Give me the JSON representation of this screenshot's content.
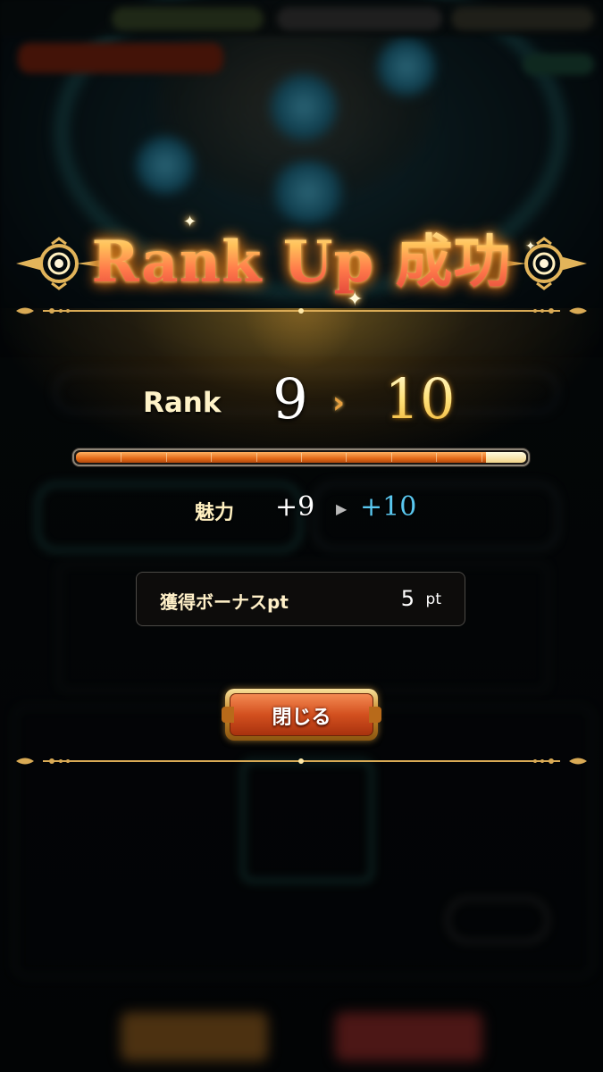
{
  "dialog": {
    "title": "Rank Up 成功",
    "rank": {
      "label": "Rank",
      "old_value": "9",
      "new_value": "10"
    },
    "progress": {
      "fraction": 0.91,
      "segments": 10
    },
    "stat": {
      "label": "魅力",
      "old_value": "+9",
      "new_value": "+10"
    },
    "bonus": {
      "label": "獲得ボーナスpt",
      "value": "5",
      "unit": "pt"
    },
    "close_button": "閉じる"
  },
  "colors": {
    "title_gradient_top": "#fff2b8",
    "title_gradient_bottom": "#e0403a",
    "rank_new": "#ffe27a",
    "stat_new": "#5ac8f0",
    "progress_fill": "#e46a18",
    "button_fill": "#d3501f",
    "gold_ornament": "#e2b45a"
  },
  "icons": {
    "title_left": "eye-ornament-icon",
    "title_right": "eye-ornament-icon",
    "rank_arrow": "chevron-right-icon",
    "stat_arrow": "triangle-right-icon"
  }
}
